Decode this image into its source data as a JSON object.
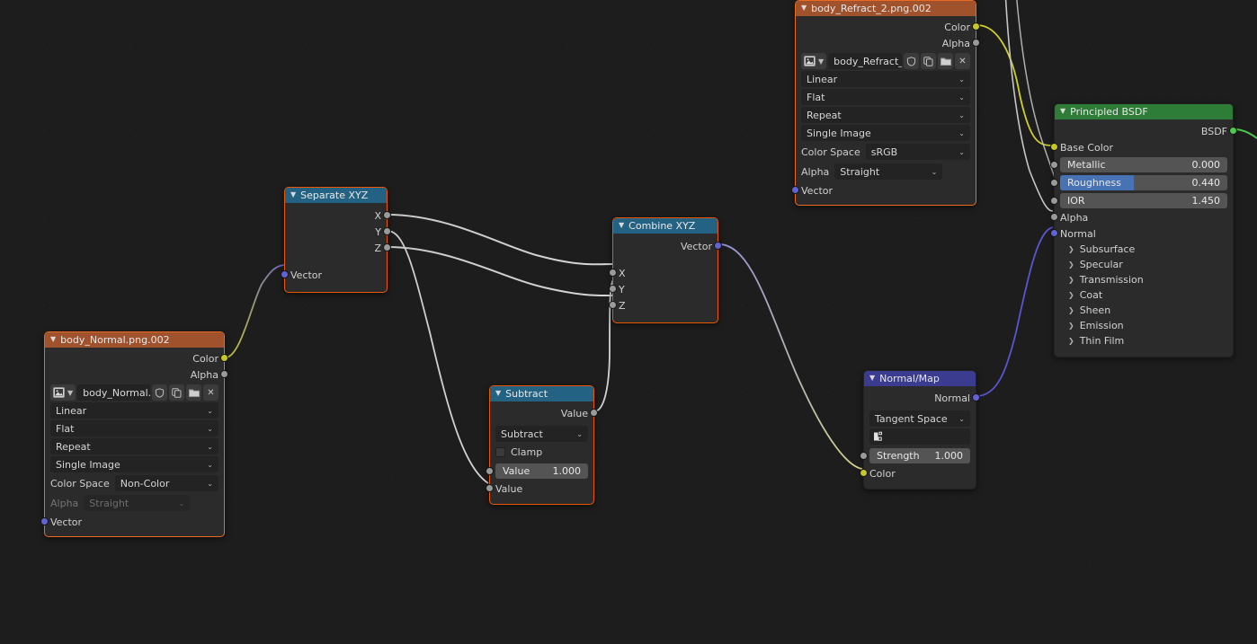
{
  "app": {
    "editor": "shader-node-editor",
    "background": "#1d1d1d"
  },
  "colors": {
    "texture_header": "#a0522d",
    "converter_header": "#246283",
    "shader_header": "#2d7c37",
    "vector_header": "#3b3b8f",
    "selection_outline": "#ed5700",
    "socket_color": "#c7c729",
    "socket_vector": "#6262d5",
    "socket_value": "#9a9a9a",
    "socket_shader": "#4ec94e",
    "slider_fill": "#4772b3"
  },
  "nodes": {
    "body_refract": {
      "title": "body_Refract_2.png.002",
      "outputs": [
        {
          "label": "Color",
          "socket": "color-socket"
        },
        {
          "label": "Alpha",
          "socket": "value-socket"
        }
      ],
      "image_name": "body_Refract_2....",
      "image_buttons": [
        "shield-icon",
        "copy-icon",
        "folder-icon",
        "close-icon"
      ],
      "interpolation": "Linear",
      "projection": "Flat",
      "extension": "Repeat",
      "source": "Single Image",
      "color_space_label": "Color Space",
      "color_space": "sRGB",
      "alpha_label": "Alpha",
      "alpha_mode": "Straight",
      "inputs": [
        {
          "label": "Vector",
          "socket": "vector-socket"
        }
      ]
    },
    "body_normal": {
      "title": "body_Normal.png.002",
      "outputs": [
        {
          "label": "Color",
          "socket": "color-socket"
        },
        {
          "label": "Alpha",
          "socket": "value-socket"
        }
      ],
      "image_name": "body_Normal.pn...",
      "image_buttons": [
        "shield-icon",
        "copy-icon",
        "folder-icon",
        "close-icon"
      ],
      "interpolation": "Linear",
      "projection": "Flat",
      "extension": "Repeat",
      "source": "Single Image",
      "color_space_label": "Color Space",
      "color_space": "Non-Color",
      "alpha_label": "Alpha",
      "alpha_mode": "Straight",
      "inputs": [
        {
          "label": "Vector",
          "socket": "vector-socket"
        }
      ]
    },
    "separate_xyz": {
      "title": "Separate XYZ",
      "outputs": [
        {
          "label": "X",
          "socket": "value-socket"
        },
        {
          "label": "Y",
          "socket": "value-socket"
        },
        {
          "label": "Z",
          "socket": "value-socket"
        }
      ],
      "inputs": [
        {
          "label": "Vector",
          "socket": "vector-socket"
        }
      ]
    },
    "combine_xyz": {
      "title": "Combine XYZ",
      "outputs": [
        {
          "label": "Vector",
          "socket": "vector-socket"
        }
      ],
      "inputs": [
        {
          "label": "X",
          "socket": "value-socket"
        },
        {
          "label": "Y",
          "socket": "value-socket"
        },
        {
          "label": "Z",
          "socket": "value-socket"
        }
      ]
    },
    "subtract": {
      "title": "Subtract",
      "outputs": [
        {
          "label": "Value",
          "socket": "value-socket"
        }
      ],
      "operation": "Subtract",
      "clamp_label": "Clamp",
      "clamp_checked": false,
      "value_a_label": "Value",
      "value_a": "1.000",
      "value_b_label": "Value"
    },
    "normal_map": {
      "title": "Normal/Map",
      "outputs": [
        {
          "label": "Normal",
          "socket": "vector-socket"
        }
      ],
      "space": "Tangent Space",
      "uv_map": "",
      "strength_label": "Strength",
      "strength_value": "1.000",
      "inputs": [
        {
          "label": "Color",
          "socket": "color-socket"
        }
      ]
    },
    "principled_bsdf": {
      "title": "Principled BSDF",
      "outputs": [
        {
          "label": "BSDF",
          "socket": "shader-socket"
        }
      ],
      "base_color_label": "Base Color",
      "sliders": [
        {
          "label": "Metallic",
          "value": "0.000",
          "fill": 0
        },
        {
          "label": "Roughness",
          "value": "0.440",
          "fill": 44
        },
        {
          "label": "IOR",
          "value": "1.450",
          "fill": 0
        }
      ],
      "alpha_label": "Alpha",
      "normal_label": "Normal",
      "panels": [
        "Subsurface",
        "Specular",
        "Transmission",
        "Coat",
        "Sheen",
        "Emission",
        "Thin Film"
      ]
    }
  }
}
